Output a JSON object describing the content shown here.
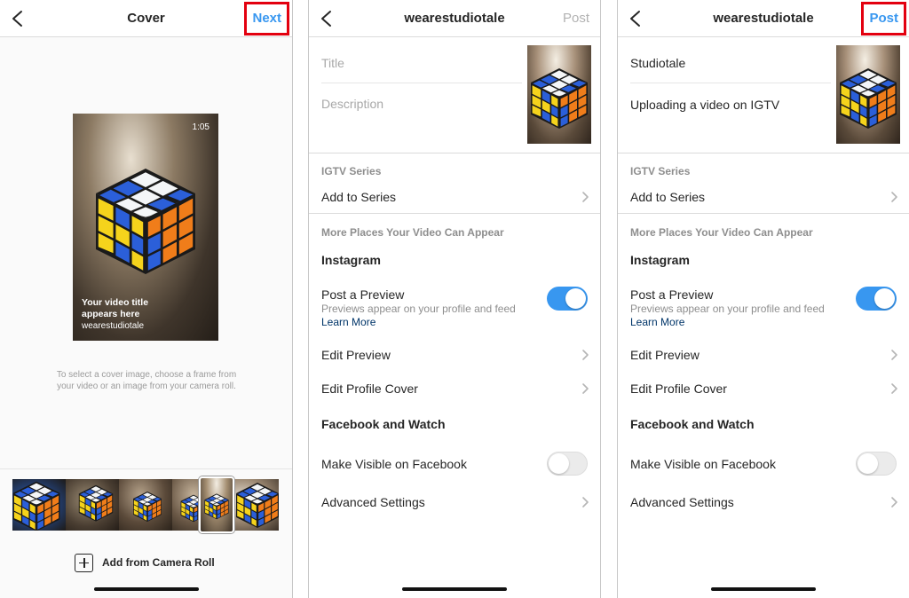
{
  "cover_screen": {
    "title": "Cover",
    "next_label": "Next",
    "preview": {
      "duration": "1:05",
      "caption_title_line1": "Your video title",
      "caption_title_line2": "appears here",
      "caption_user": "wearestudiotale"
    },
    "hint_line1": "To select a cover image, choose a frame from",
    "hint_line2": "your video or an image from your camera roll.",
    "add_camera_roll_label": "Add from Camera Roll"
  },
  "details_empty": {
    "title": "wearestudiotale",
    "post_label": "Post",
    "title_placeholder": "Title",
    "description_placeholder": "Description",
    "igtv_series_label": "IGTV Series",
    "add_to_series": "Add to Series",
    "more_places_label": "More Places Your Video Can Appear",
    "instagram_title": "Instagram",
    "post_preview": "Post a Preview",
    "post_preview_sub": "Previews appear on your profile and feed",
    "learn_more": "Learn More",
    "post_preview_on": true,
    "edit_preview": "Edit Preview",
    "edit_profile_cover": "Edit Profile Cover",
    "facebook_title": "Facebook and Watch",
    "make_visible": "Make Visible on Facebook",
    "make_visible_on": false,
    "advanced_settings": "Advanced Settings"
  },
  "details_filled": {
    "title": "wearestudiotale",
    "post_label": "Post",
    "title_value": "Studiotale",
    "description_value": "Uploading a video on IGTV",
    "igtv_series_label": "IGTV Series",
    "add_to_series": "Add to Series",
    "more_places_label": "More Places Your Video Can Appear",
    "instagram_title": "Instagram",
    "post_preview": "Post a Preview",
    "post_preview_sub": "Previews appear on your profile and feed",
    "learn_more": "Learn More",
    "post_preview_on": true,
    "edit_preview": "Edit Preview",
    "edit_profile_cover": "Edit Profile Cover",
    "facebook_title": "Facebook and Watch",
    "make_visible": "Make Visible on Facebook",
    "make_visible_on": false,
    "advanced_settings": "Advanced Settings"
  },
  "colors": {
    "accent_blue": "#3897f0",
    "highlight_red": "#e3000f",
    "link_blue": "#003569"
  },
  "icons": [
    "back-chevron-icon",
    "chevron-right-icon",
    "plus-square-icon",
    "rubiks-cube-image"
  ]
}
